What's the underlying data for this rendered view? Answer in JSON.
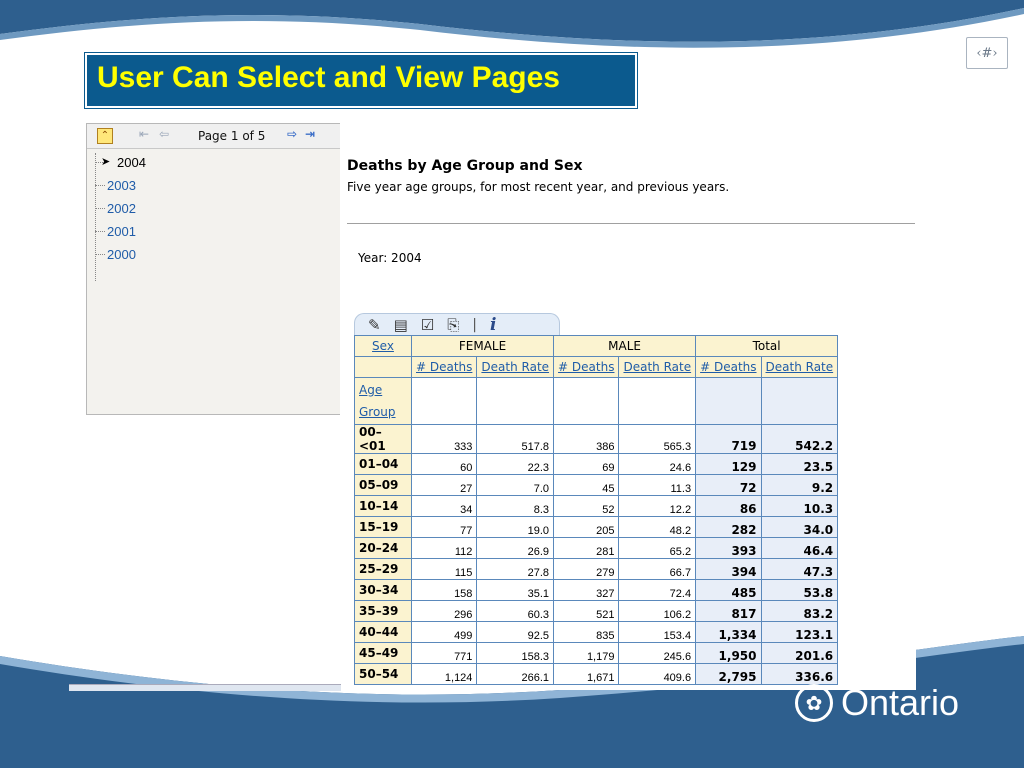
{
  "slide": {
    "number_label": "‹#›",
    "title": "User Can Select and View Pages",
    "brand": "Ontario",
    "brand_icon": "trillium-icon",
    "colors": {
      "title_bg": "#0b5a8e",
      "title_text": "#ffff00",
      "wave": "#2e5f8e"
    }
  },
  "tree": {
    "page_label": "Page 1 of 5",
    "items": [
      {
        "label": "2004",
        "selected": true
      },
      {
        "label": "2003",
        "selected": false
      },
      {
        "label": "2002",
        "selected": false
      },
      {
        "label": "2001",
        "selected": false
      },
      {
        "label": "2000",
        "selected": false
      }
    ]
  },
  "report": {
    "title": "Deaths by Age Group and Sex",
    "subtitle": "Five year age groups, for most recent year, and previous years.",
    "year_label": "Year: 2004"
  },
  "table": {
    "sex_header": "Sex",
    "groups": [
      "FEMALE",
      "MALE",
      "Total"
    ],
    "subheaders": [
      "# Deaths",
      "Death Rate",
      "# Deaths",
      "Death Rate",
      "# Deaths",
      "Death Rate"
    ],
    "age_header_line1": "Age",
    "age_header_line2": "Group",
    "rows": [
      {
        "age": "00–<01",
        "values": [
          "333",
          "517.8",
          "386",
          "565.3",
          "719",
          "542.2"
        ]
      },
      {
        "age": "01–04",
        "values": [
          "60",
          "22.3",
          "69",
          "24.6",
          "129",
          "23.5"
        ]
      },
      {
        "age": "05–09",
        "values": [
          "27",
          "7.0",
          "45",
          "11.3",
          "72",
          "9.2"
        ]
      },
      {
        "age": "10–14",
        "values": [
          "34",
          "8.3",
          "52",
          "12.2",
          "86",
          "10.3"
        ]
      },
      {
        "age": "15–19",
        "values": [
          "77",
          "19.0",
          "205",
          "48.2",
          "282",
          "34.0"
        ]
      },
      {
        "age": "20–24",
        "values": [
          "112",
          "26.9",
          "281",
          "65.2",
          "393",
          "46.4"
        ]
      },
      {
        "age": "25–29",
        "values": [
          "115",
          "27.8",
          "279",
          "66.7",
          "394",
          "47.3"
        ]
      },
      {
        "age": "30–34",
        "values": [
          "158",
          "35.1",
          "327",
          "72.4",
          "485",
          "53.8"
        ]
      },
      {
        "age": "35–39",
        "values": [
          "296",
          "60.3",
          "521",
          "106.2",
          "817",
          "83.2"
        ]
      },
      {
        "age": "40–44",
        "values": [
          "499",
          "92.5",
          "835",
          "153.4",
          "1,334",
          "123.1"
        ]
      },
      {
        "age": "45–49",
        "values": [
          "771",
          "158.3",
          "1,179",
          "245.6",
          "1,950",
          "201.6"
        ]
      },
      {
        "age": "50–54",
        "values": [
          "1,124",
          "266.1",
          "1,671",
          "409.6",
          "2,795",
          "336.6"
        ]
      }
    ]
  }
}
